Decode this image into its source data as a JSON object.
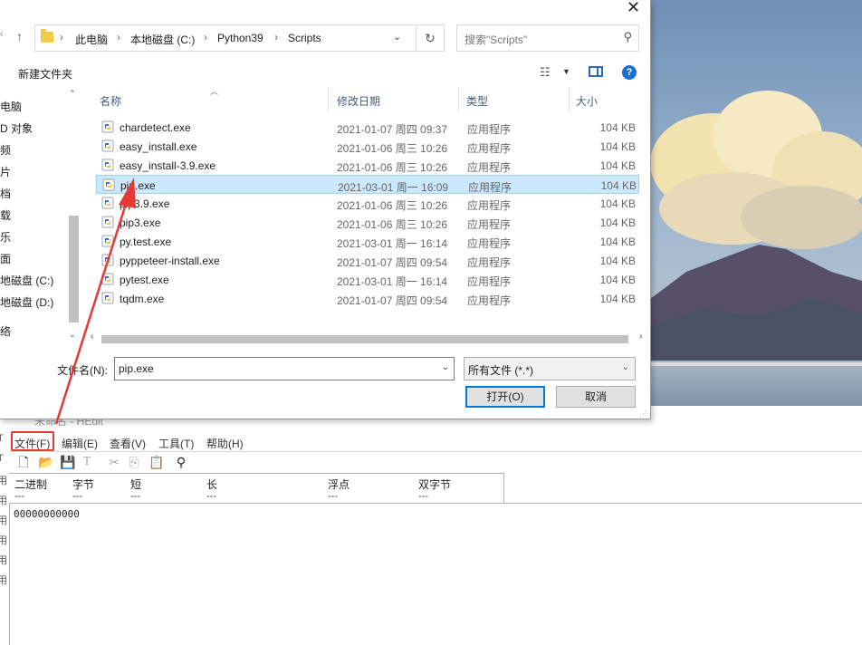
{
  "dialog": {
    "address": {
      "crumbs": [
        "此电脑",
        "本地磁盘 (C:)",
        "Python39",
        "Scripts"
      ]
    },
    "search_placeholder": "搜索\"Scripts\"",
    "new_folder_label": "新建文件夹",
    "nav_items": [
      "电脑",
      "D 对象",
      "频",
      "片",
      "档",
      "载",
      "乐",
      "面",
      "地磁盘 (C:)",
      "地磁盘 (D:)",
      "络"
    ],
    "columns": {
      "name": "名称",
      "date": "修改日期",
      "type": "类型",
      "size": "大小"
    },
    "files": [
      {
        "name": "chardetect.exe",
        "date": "2021-01-07 周四 09:37",
        "type": "应用程序",
        "size": "104 KB"
      },
      {
        "name": "easy_install.exe",
        "date": "2021-01-06 周三 10:26",
        "type": "应用程序",
        "size": "104 KB"
      },
      {
        "name": "easy_install-3.9.exe",
        "date": "2021-01-06 周三 10:26",
        "type": "应用程序",
        "size": "104 KB"
      },
      {
        "name": "pip.exe",
        "date": "2021-03-01 周一 16:09",
        "type": "应用程序",
        "size": "104 KB"
      },
      {
        "name": "pip3.9.exe",
        "date": "2021-01-06 周三 10:26",
        "type": "应用程序",
        "size": "104 KB"
      },
      {
        "name": "pip3.exe",
        "date": "2021-01-06 周三 10:26",
        "type": "应用程序",
        "size": "104 KB"
      },
      {
        "name": "py.test.exe",
        "date": "2021-03-01 周一 16:14",
        "type": "应用程序",
        "size": "104 KB"
      },
      {
        "name": "pyppeteer-install.exe",
        "date": "2021-01-07 周四 09:54",
        "type": "应用程序",
        "size": "104 KB"
      },
      {
        "name": "pytest.exe",
        "date": "2021-03-01 周一 16:14",
        "type": "应用程序",
        "size": "104 KB"
      },
      {
        "name": "tqdm.exe",
        "date": "2021-01-07 周四 09:54",
        "type": "应用程序",
        "size": "104 KB"
      }
    ],
    "selected_index": 3,
    "filename_label": "文件名(N):",
    "filename_value": "pip.exe",
    "filetype_value": "所有文件 (*.*)",
    "open_label": "打开(O)",
    "cancel_label": "取消"
  },
  "hex_editor": {
    "title": "未命名 - HEdit",
    "menu": [
      "文件(F)",
      "编辑(E)",
      "查看(V)",
      "工具(T)",
      "帮助(H)"
    ],
    "columns": [
      "二进制",
      "字节",
      "短",
      "长",
      "浮点",
      "双字节"
    ],
    "column_placeholder": "---",
    "value": "00000000000",
    "gutter_chars": [
      "T",
      "T",
      "用",
      "用",
      "用",
      "用",
      "用",
      "用"
    ]
  },
  "colors": {
    "selection_bg": "#cce8ff",
    "annotation_red": "#e53935",
    "accent_blue": "#0078d7"
  }
}
